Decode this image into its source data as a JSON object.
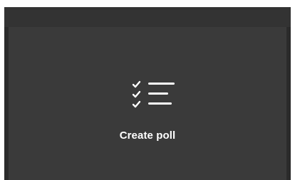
{
  "create_poll": {
    "label": "Create poll",
    "icon": "checklist-icon"
  },
  "colors": {
    "window_bg": "#2b2b2b",
    "top_strip": "#333333",
    "panel_bg": "#3a3a3a",
    "text": "#ffffff"
  }
}
